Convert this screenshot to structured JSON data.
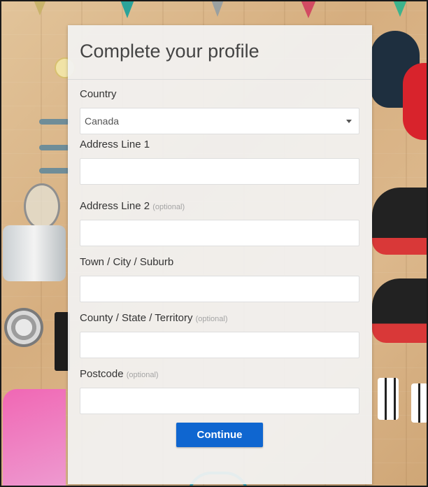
{
  "form": {
    "title": "Complete your profile",
    "country": {
      "label": "Country",
      "value": "Canada"
    },
    "address1": {
      "label": "Address Line 1",
      "value": ""
    },
    "address2": {
      "label": "Address Line 2",
      "optional": "(optional)",
      "value": ""
    },
    "town": {
      "label": "Town / City / Suburb",
      "value": ""
    },
    "county": {
      "label": "County / State / Territory",
      "optional": "(optional)",
      "value": ""
    },
    "postcode": {
      "label": "Postcode",
      "optional": "(optional)",
      "value": ""
    },
    "continue_label": "Continue"
  },
  "colors": {
    "accent": "#0f66d0",
    "card": "#f2f2f2",
    "optional_text": "#a4a4a4"
  },
  "icons": {
    "country_select": "chevron-down-icon"
  }
}
